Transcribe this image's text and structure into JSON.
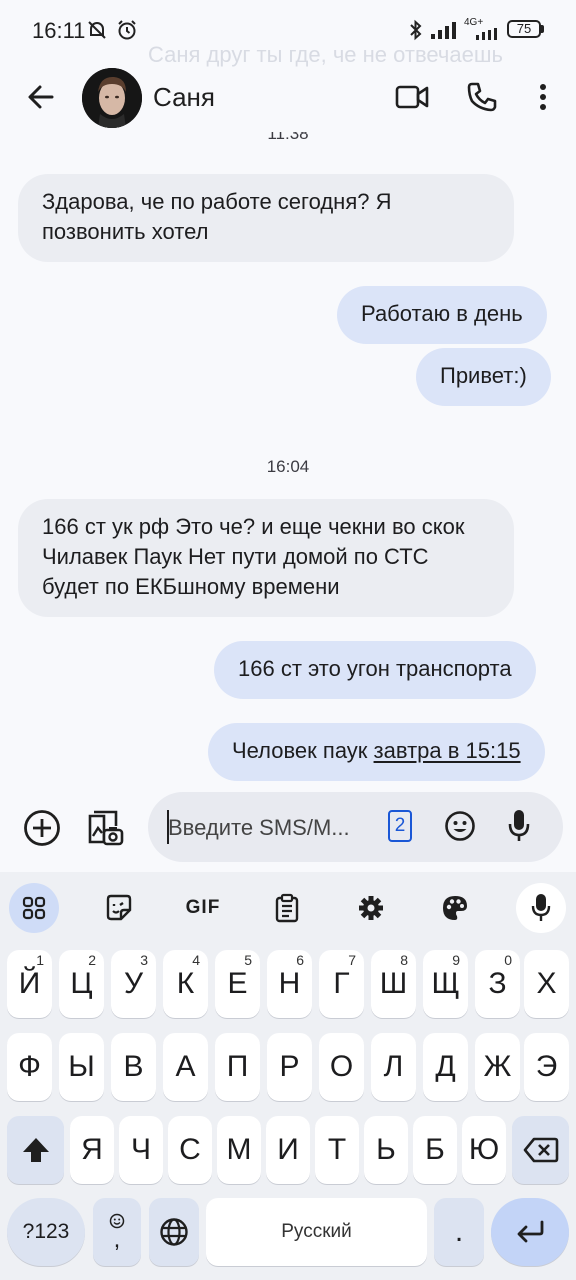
{
  "status_bar": {
    "time": "16:11",
    "battery": "75",
    "network": "4G+",
    "ghost_notification": "Саня друг ты где, че не отвечаешь"
  },
  "header": {
    "contact_name": "Саня",
    "icons": [
      "back-arrow-icon",
      "video-call-icon",
      "phone-icon",
      "more-vert-icon"
    ]
  },
  "messages": {
    "partial_time": "11:38",
    "m1": "Здарова, че по работе сегодня? Я позвонить хотел",
    "m2": "Работаю в день",
    "m3": "Привет:)",
    "time2": "16:04",
    "m4": "166 ст ук рф Это че? и еще чекни во скок Чилавек Паук Нет пути домой по СТС будет по ЕКБшному времени",
    "m5": "166 ст это угон транспорта",
    "m6_prefix": "Человек паук ",
    "m6_link": "завтра в 15:15"
  },
  "composer": {
    "placeholder": "Введите SMS/M...",
    "sim": "2"
  },
  "keyboard": {
    "toolbar": [
      "apps-grid-icon",
      "sticker-icon",
      "GIF",
      "clipboard-icon",
      "settings-icon",
      "palette-icon",
      "mic-icon"
    ],
    "gif_label": "GIF",
    "row1": [
      "Й",
      "Ц",
      "У",
      "К",
      "Е",
      "Н",
      "Г",
      "Ш",
      "Щ",
      "З",
      "Х"
    ],
    "row1_hints": [
      "1",
      "2",
      "3",
      "4",
      "5",
      "6",
      "7",
      "8",
      "9",
      "0",
      ""
    ],
    "row2": [
      "Ф",
      "Ы",
      "В",
      "А",
      "П",
      "Р",
      "О",
      "Л",
      "Д",
      "Ж",
      "Э"
    ],
    "row3": [
      "Я",
      "Ч",
      "С",
      "М",
      "И",
      "Т",
      "Ь",
      "Б",
      "Ю"
    ],
    "symbols": "?123",
    "comma": ",",
    "space": "Русский",
    "period": "."
  }
}
